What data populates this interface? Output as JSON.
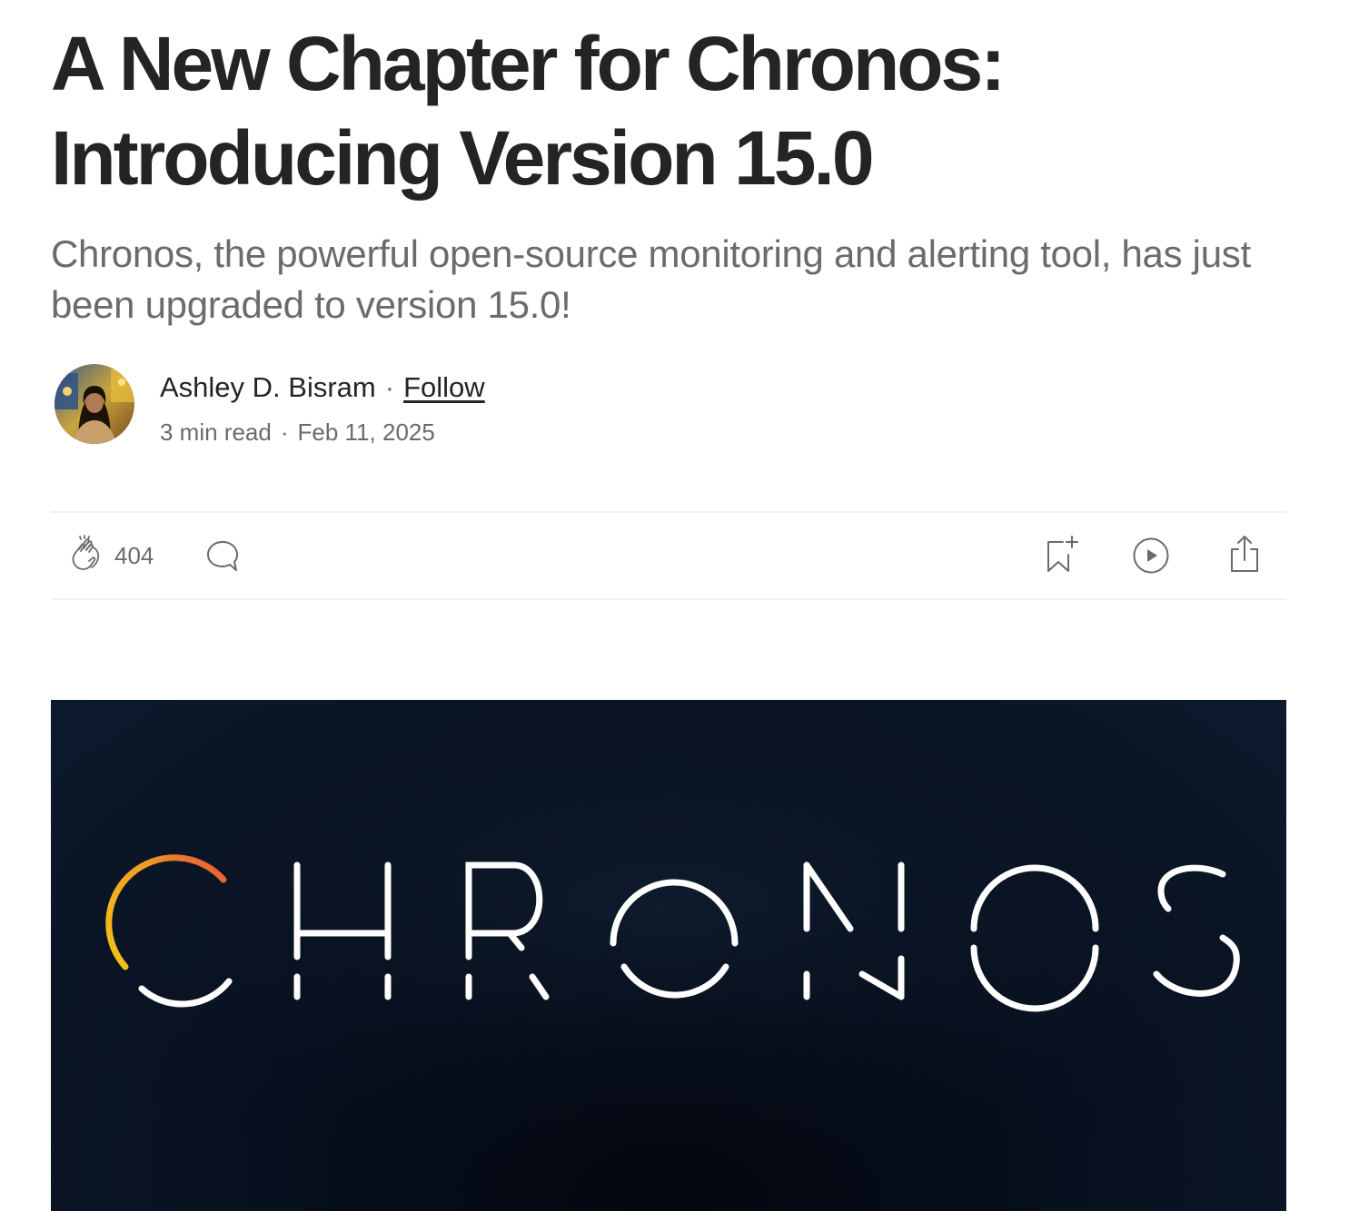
{
  "article": {
    "title_line1": "A New Chapter for Chronos:",
    "title_line2": "Introducing Version 15.0",
    "subtitle": "Chronos, the powerful open-source monitoring and alerting tool, has just been upgraded to version 15.0!"
  },
  "byline": {
    "author": "Ashley D. Bisram",
    "separator": "·",
    "follow_label": "Follow",
    "read_time": "3 min read",
    "date": "Feb 11, 2025",
    "avatar_icon": "author-avatar"
  },
  "actions": {
    "clap_count": "404",
    "icons": [
      "clap-icon",
      "comment-icon",
      "bookmark-add-icon",
      "play-icon",
      "share-icon"
    ]
  },
  "hero": {
    "logo_text": "CHRONOS",
    "colors": {
      "background": "#0a1424",
      "letters": "#ffffff",
      "arc_start": "#f2c21b",
      "arc_end": "#e8523a"
    }
  }
}
